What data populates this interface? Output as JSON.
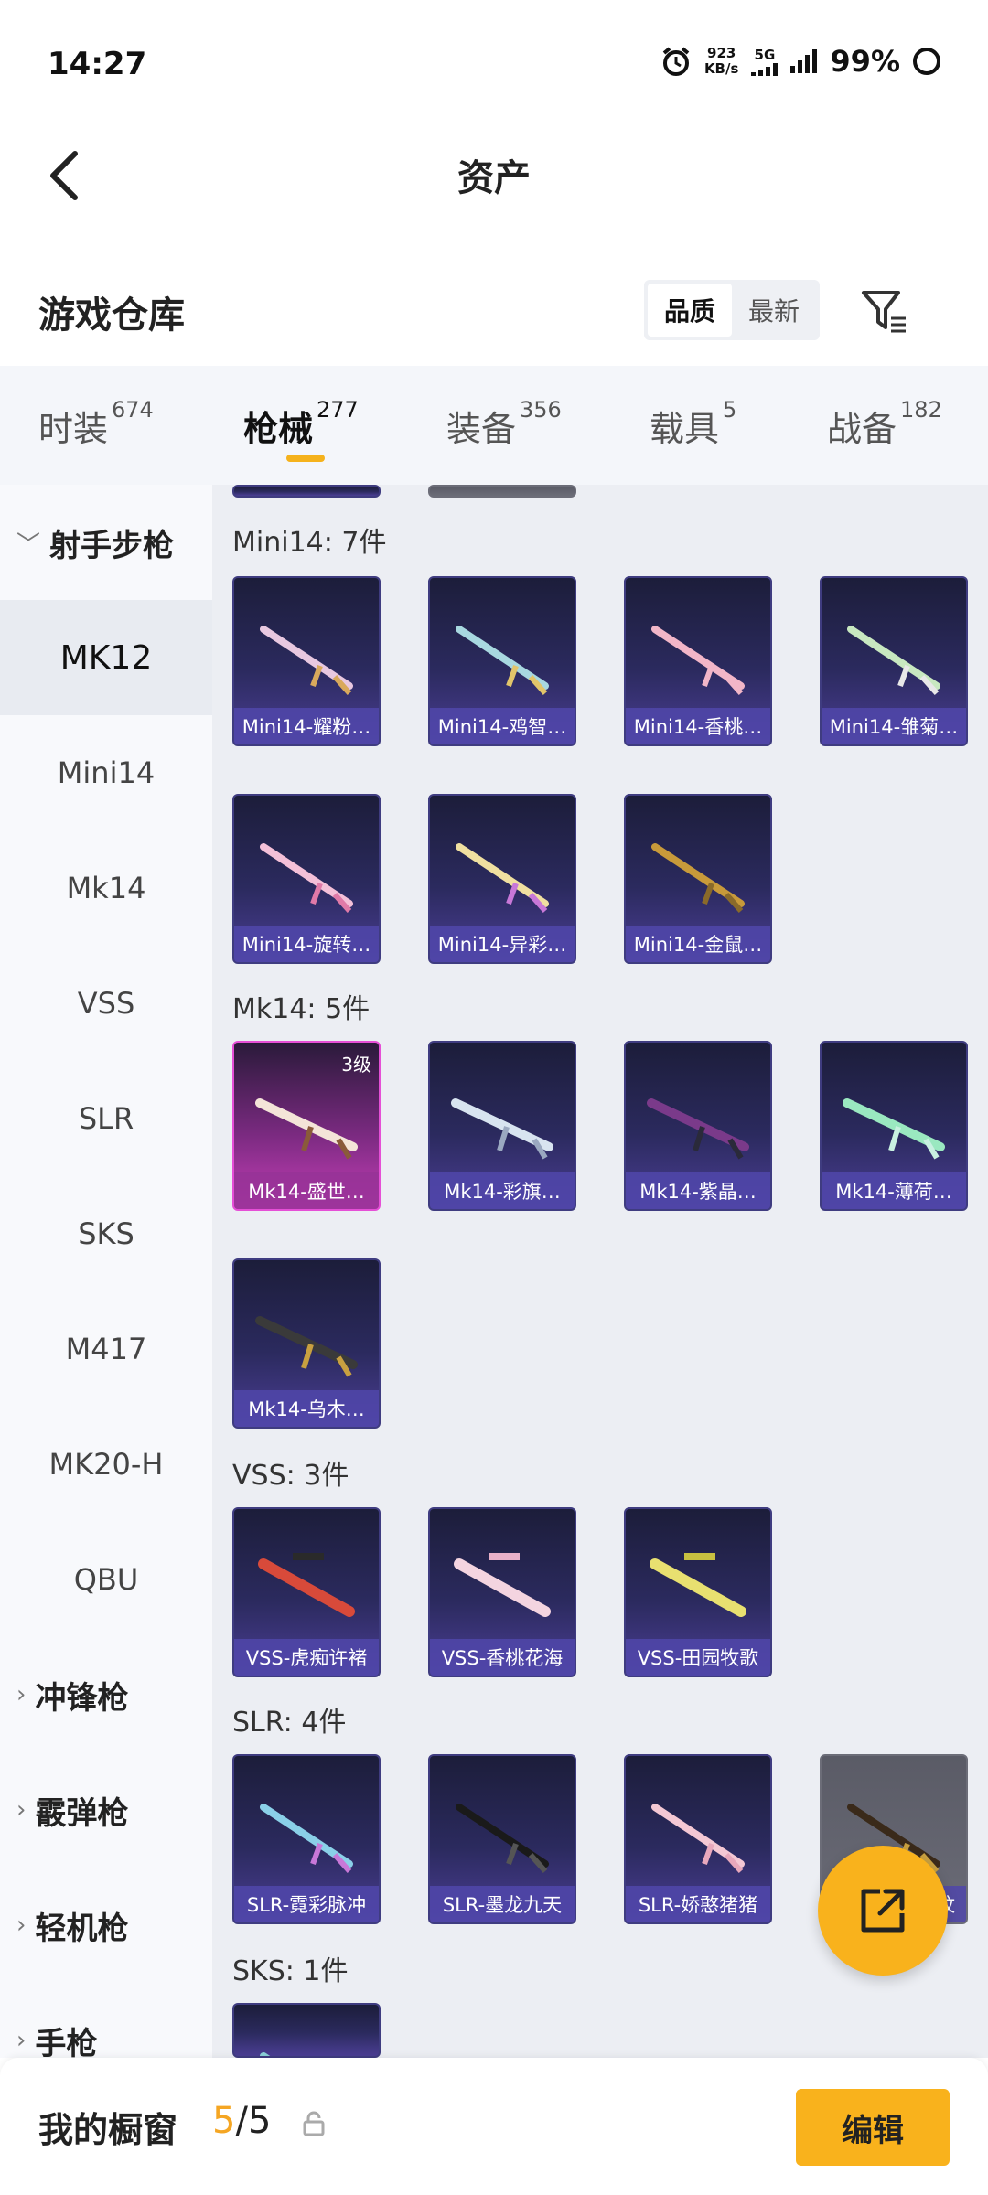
{
  "status_bar": {
    "time": "14:27",
    "net_speed_value": "923",
    "net_speed_unit": "KB/s",
    "network": "5G",
    "battery": "99%"
  },
  "nav": {
    "title": "资产",
    "back_icon": "chevron-left-icon"
  },
  "section": {
    "title": "游戏仓库",
    "sort_options": [
      "品质",
      "最新"
    ],
    "sort_active": "品质",
    "filter_icon": "filter-icon"
  },
  "category_tabs": [
    {
      "label": "时装",
      "count": "674"
    },
    {
      "label": "枪械",
      "count": "277",
      "active": true
    },
    {
      "label": "装备",
      "count": "356"
    },
    {
      "label": "载具",
      "count": "5"
    },
    {
      "label": "战备",
      "count": "182"
    }
  ],
  "sidebar": {
    "group_marksman": "射手步枪",
    "items": [
      "MK12",
      "Mini14",
      "Mk14",
      "VSS",
      "SLR",
      "SKS",
      "M417",
      "MK20-H",
      "QBU"
    ],
    "active_item": "MK12",
    "group_smg": "冲锋枪",
    "group_shotgun": "霰弹枪",
    "group_lmg": "轻机枪",
    "group_pistol": "手枪"
  },
  "groups": {
    "mini14": {
      "label": "Mini14: 7件",
      "cards": [
        "Mini14-耀粉…",
        "Mini14-鸡智…",
        "Mini14-香桃…",
        "Mini14-雏菊…",
        "Mini14-旋转…",
        "Mini14-异彩…",
        "Mini14-金鼠…"
      ]
    },
    "mk14": {
      "label": "Mk14: 5件",
      "cards": [
        "Mk14-盛世…",
        "Mk14-彩旗…",
        "Mk14-紫晶…",
        "Mk14-薄荷…",
        "Mk14-乌木…"
      ],
      "first_level": "3级"
    },
    "vss": {
      "label": "VSS: 3件",
      "cards": [
        "VSS-虎痴许褚",
        "VSS-香桃花海",
        "VSS-田园牧歌"
      ]
    },
    "slr": {
      "label": "SLR: 4件",
      "cards": [
        "SLR-霓彩脉冲",
        "SLR-墨龙九天",
        "SLR-娇憨猪猪",
        "纹"
      ]
    },
    "sks": {
      "label": "SKS: 1件"
    }
  },
  "colors": {
    "accent": "#f9b21c",
    "card_purple": "#2b2a5e",
    "card_pink": "#c63fb8"
  },
  "bottom": {
    "title": "我的橱窗",
    "current": "5",
    "separator": "/",
    "max": "5",
    "edit_label": "编辑",
    "lock_icon": "lock-icon"
  },
  "fab_icon": "share-icon"
}
